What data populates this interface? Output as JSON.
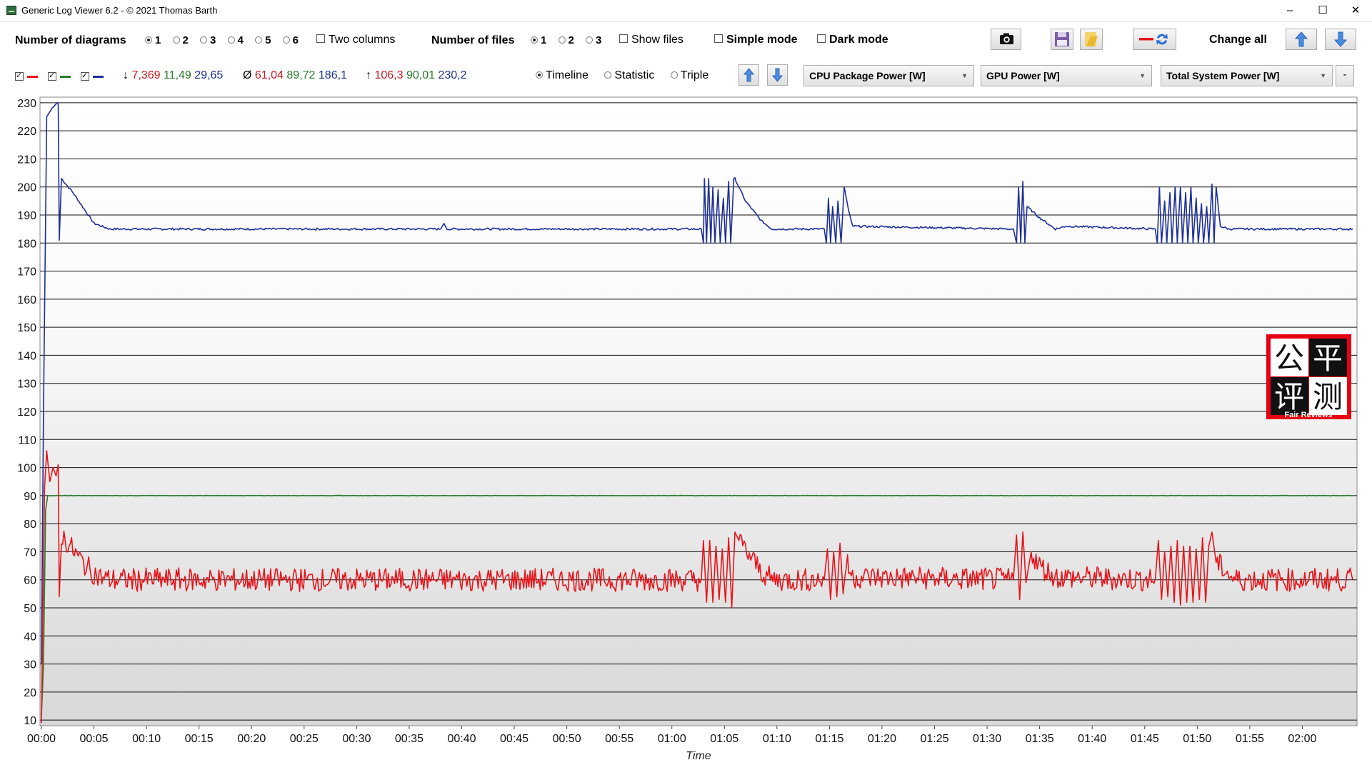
{
  "window": {
    "title": "Generic Log Viewer 6.2 - © 2021 Thomas Barth",
    "minimize": "–",
    "maximize": "☐",
    "close": "✕"
  },
  "toolbar": {
    "num_diagrams_label": "Number of diagrams",
    "diagram_options": [
      "1",
      "2",
      "3",
      "4",
      "5",
      "6"
    ],
    "diagram_selected": "1",
    "two_columns_label": "Two columns",
    "num_files_label": "Number of files",
    "file_options": [
      "1",
      "2",
      "3"
    ],
    "file_selected": "1",
    "show_files_label": "Show files",
    "simple_mode_label": "Simple mode",
    "dark_mode_label": "Dark mode",
    "change_all_label": "Change all",
    "icons": [
      "camera-icon",
      "save-icon",
      "folder-icon",
      "swap-series-icon",
      "arrow-up-icon",
      "arrow-down-icon"
    ]
  },
  "series_bar": {
    "stats_min": {
      "symbol": "↓",
      "values": [
        "7,369",
        "11,49",
        "29,65"
      ]
    },
    "stats_avg": {
      "symbol": "Ø",
      "values": [
        "61,04",
        "89,72",
        "186,1"
      ]
    },
    "stats_max": {
      "symbol": "↑",
      "values": [
        "106,3",
        "90,01",
        "230,2"
      ]
    },
    "view_options": [
      "Timeline",
      "Statistic",
      "Triple"
    ],
    "view_selected": "Timeline",
    "dropdowns": [
      "CPU Package Power [W]",
      "GPU Power [W]",
      "Total System Power [W]"
    ],
    "remove_label": "-"
  },
  "colors": {
    "red": "#e8141a",
    "green": "#2a7d2a",
    "blue": "#1c2f9a"
  },
  "watermark": {
    "chars": [
      "公",
      "平",
      "评",
      "测"
    ],
    "sub": "Fair Reviews"
  },
  "chart_data": {
    "type": "line",
    "xlabel": "Time",
    "ylabel": "",
    "ylim": [
      8,
      232
    ],
    "yticks": [
      10,
      20,
      30,
      40,
      50,
      60,
      70,
      80,
      90,
      100,
      110,
      120,
      130,
      140,
      150,
      160,
      170,
      180,
      190,
      200,
      210,
      220,
      230
    ],
    "xlim_seconds": [
      0,
      125
    ],
    "xticks": [
      "00:00",
      "00:05",
      "00:10",
      "00:15",
      "00:20",
      "00:25",
      "00:30",
      "00:35",
      "00:40",
      "00:45",
      "00:50",
      "00:55",
      "01:00",
      "01:05",
      "01:10",
      "01:15",
      "01:20",
      "01:25",
      "01:30",
      "01:35",
      "01:40",
      "01:45",
      "01:50",
      "01:55",
      "02:00"
    ],
    "grid": true,
    "series": [
      {
        "color": "#1c2f9a",
        "points": [
          [
            0,
            30
          ],
          [
            0.2,
            120
          ],
          [
            0.5,
            225
          ],
          [
            1.0,
            228
          ],
          [
            1.5,
            230
          ],
          [
            1.6,
            230
          ],
          [
            1.7,
            181
          ],
          [
            1.9,
            203
          ],
          [
            3,
            198
          ],
          [
            5,
            187
          ],
          [
            6.5,
            185
          ],
          [
            20,
            185
          ],
          [
            38,
            185
          ],
          [
            38.3,
            187
          ],
          [
            38.6,
            185
          ],
          [
            62.8,
            185
          ],
          [
            63,
            180
          ],
          [
            63.1,
            203
          ],
          [
            63.3,
            180
          ],
          [
            63.5,
            203
          ],
          [
            63.7,
            180
          ],
          [
            63.9,
            200
          ],
          [
            64.1,
            180
          ],
          [
            64.4,
            199
          ],
          [
            64.6,
            180
          ],
          [
            64.9,
            196
          ],
          [
            65.1,
            180
          ],
          [
            65.4,
            202
          ],
          [
            65.6,
            180
          ],
          [
            65.9,
            203
          ],
          [
            66.0,
            203
          ],
          [
            67,
            195
          ],
          [
            68.5,
            188
          ],
          [
            69.5,
            185
          ],
          [
            74.5,
            185
          ],
          [
            74.7,
            180
          ],
          [
            74.9,
            196
          ],
          [
            75.1,
            180
          ],
          [
            75.3,
            193
          ],
          [
            75.6,
            180
          ],
          [
            75.8,
            195
          ],
          [
            76.1,
            180
          ],
          [
            76.4,
            200
          ],
          [
            76.8,
            192
          ],
          [
            77.2,
            186
          ],
          [
            92.5,
            185
          ],
          [
            92.8,
            180
          ],
          [
            93.0,
            200
          ],
          [
            93.2,
            180
          ],
          [
            93.4,
            202
          ],
          [
            93.6,
            180
          ],
          [
            93.8,
            193
          ],
          [
            95,
            189
          ],
          [
            96.5,
            185
          ],
          [
            97.5,
            186
          ],
          [
            106,
            185
          ],
          [
            106.2,
            180
          ],
          [
            106.4,
            200
          ],
          [
            106.6,
            180
          ],
          [
            106.9,
            195
          ],
          [
            107.1,
            180
          ],
          [
            107.4,
            198
          ],
          [
            107.6,
            180
          ],
          [
            107.9,
            200
          ],
          [
            108.1,
            180
          ],
          [
            108.4,
            200
          ],
          [
            108.6,
            180
          ],
          [
            108.9,
            198
          ],
          [
            109.1,
            180
          ],
          [
            109.4,
            200
          ],
          [
            109.6,
            180
          ],
          [
            109.9,
            196
          ],
          [
            110.1,
            180
          ],
          [
            110.4,
            194
          ],
          [
            110.6,
            180
          ],
          [
            110.9,
            193
          ],
          [
            111.1,
            180
          ],
          [
            111.4,
            201
          ],
          [
            111.6,
            180
          ],
          [
            111.8,
            200
          ],
          [
            112.2,
            186
          ],
          [
            113,
            185
          ],
          [
            115,
            185
          ],
          [
            124.8,
            185
          ]
        ]
      },
      {
        "color": "#2a7d2a",
        "points": [
          [
            0,
            11.5
          ],
          [
            0.2,
            30
          ],
          [
            0.4,
            85
          ],
          [
            0.6,
            90
          ],
          [
            124.8,
            90
          ]
        ]
      },
      {
        "color": "#e8141a",
        "points": [
          [
            0,
            9
          ],
          [
            0.3,
            93
          ],
          [
            0.5,
            106
          ],
          [
            0.8,
            95
          ],
          [
            1.1,
            100
          ],
          [
            1.4,
            97
          ],
          [
            1.6,
            101
          ],
          [
            1.7,
            54
          ],
          [
            1.9,
            76
          ],
          [
            2.5,
            73
          ],
          [
            3.5,
            68
          ],
          [
            4.5,
            64
          ],
          [
            5.5,
            61
          ],
          [
            6.5,
            60
          ],
          [
            20,
            60
          ],
          [
            30,
            60
          ],
          [
            40,
            60
          ],
          [
            50,
            60
          ],
          [
            55,
            60
          ],
          [
            62.8,
            60
          ],
          [
            63,
            74
          ],
          [
            63.3,
            52
          ],
          [
            63.6,
            74
          ],
          [
            63.9,
            52
          ],
          [
            64.2,
            72
          ],
          [
            64.5,
            53
          ],
          [
            64.8,
            71
          ],
          [
            65.1,
            52
          ],
          [
            65.4,
            75
          ],
          [
            65.7,
            50
          ],
          [
            66.0,
            77
          ],
          [
            66.5,
            73
          ],
          [
            67.5,
            68
          ],
          [
            68.5,
            63
          ],
          [
            69.5,
            60
          ],
          [
            74.5,
            60
          ],
          [
            74.8,
            71
          ],
          [
            75.1,
            53
          ],
          [
            75.4,
            70
          ],
          [
            75.7,
            54
          ],
          [
            76.0,
            73
          ],
          [
            76.3,
            55
          ],
          [
            76.6,
            66
          ],
          [
            77.2,
            61
          ],
          [
            92.5,
            60
          ],
          [
            92.8,
            76
          ],
          [
            93.1,
            53
          ],
          [
            93.4,
            77
          ],
          [
            93.7,
            59
          ],
          [
            94.2,
            70
          ],
          [
            95,
            65
          ],
          [
            96.5,
            61
          ],
          [
            106,
            60
          ],
          [
            106.3,
            74
          ],
          [
            106.6,
            53
          ],
          [
            106.9,
            70
          ],
          [
            107.2,
            54
          ],
          [
            107.5,
            72
          ],
          [
            107.8,
            52
          ],
          [
            108.1,
            74
          ],
          [
            108.4,
            51
          ],
          [
            108.7,
            72
          ],
          [
            109.0,
            52
          ],
          [
            109.3,
            72
          ],
          [
            109.6,
            52
          ],
          [
            109.9,
            71
          ],
          [
            110.2,
            53
          ],
          [
            110.5,
            75
          ],
          [
            110.8,
            52
          ],
          [
            111.1,
            72
          ],
          [
            111.4,
            77
          ],
          [
            111.8,
            66
          ],
          [
            112.5,
            64
          ],
          [
            113.5,
            60
          ],
          [
            124.8,
            60
          ]
        ]
      }
    ]
  }
}
